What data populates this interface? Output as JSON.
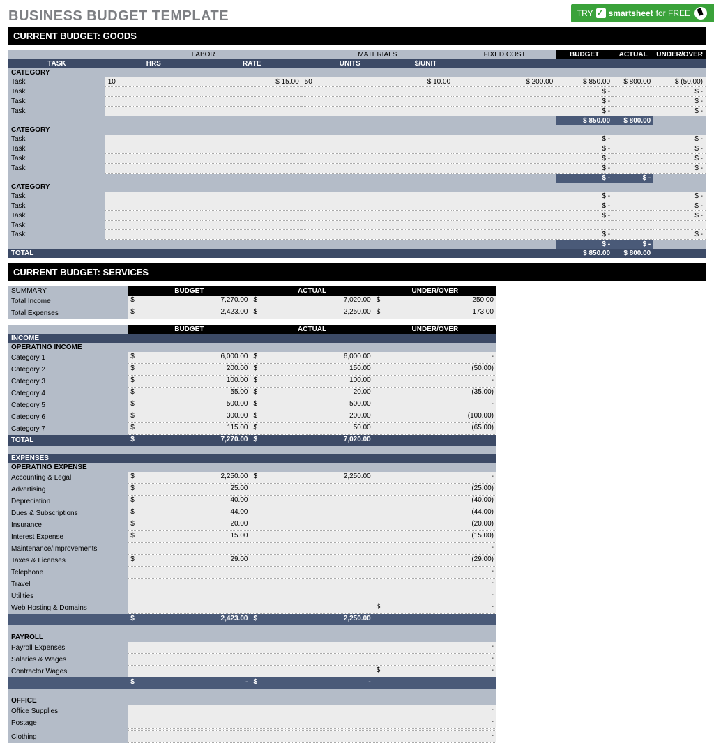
{
  "title": "BUSINESS BUDGET TEMPLATE",
  "badge": {
    "try": "TRY",
    "brand": "smartsheet",
    "tail": "for FREE"
  },
  "goods": {
    "header": "CURRENT BUDGET: GOODS",
    "groups": {
      "labor": "LABOR",
      "materials": "MATERIALS",
      "fixed": "FIXED COST",
      "budget": "BUDGET",
      "actual": "ACTUAL",
      "uo": "UNDER/OVER"
    },
    "cols": {
      "task": "TASK",
      "hrs": "HRS",
      "rate": "RATE",
      "units": "UNITS",
      "perunit": "$/UNIT"
    },
    "categories": [
      {
        "name": "CATEGORY",
        "rows": [
          {
            "task": "Task",
            "hrs": "10",
            "rate": "$        15.00",
            "units": "50",
            "perunit": "$   10.00",
            "fixed": "$ 200.00",
            "budget": "$   850.00",
            "actual": "$   800.00",
            "uo": "$   (50.00)"
          },
          {
            "task": "Task",
            "budget": "$        -",
            "uo": "$        -"
          },
          {
            "task": "Task",
            "budget": "$        -",
            "uo": "$        -"
          },
          {
            "task": "Task",
            "budget": "$        -",
            "uo": "$        -"
          }
        ],
        "sum": {
          "budget": "$   850.00",
          "actual": "$   800.00"
        }
      },
      {
        "name": "CATEGORY",
        "rows": [
          {
            "task": "Task",
            "budget": "$        -",
            "uo": "$        -"
          },
          {
            "task": "Task",
            "budget": "$        -",
            "uo": "$        -"
          },
          {
            "task": "Task",
            "budget": "$        -",
            "uo": "$        -"
          },
          {
            "task": "Task",
            "budget": "$        -",
            "uo": "$        -"
          }
        ],
        "sum": {
          "budget": "$        -",
          "actual": "$        -"
        }
      },
      {
        "name": "CATEGORY",
        "rows": [
          {
            "task": "Task",
            "budget": "$        -",
            "uo": "$        -"
          },
          {
            "task": "Task",
            "budget": "$        -",
            "uo": "$        -"
          },
          {
            "task": "Task",
            "budget": "$        -",
            "uo": "$        -"
          },
          {
            "task": "Task"
          },
          {
            "task": "Task",
            "budget": "$        -",
            "uo": "$        -"
          }
        ],
        "sum": {
          "budget": "$        -",
          "actual": "$        -"
        }
      }
    ],
    "total": {
      "label": "TOTAL",
      "budget": "$   850.00",
      "actual": "$   800.00"
    }
  },
  "services": {
    "header": "CURRENT BUDGET: SERVICES",
    "summary": {
      "label": "SUMMARY",
      "cols": {
        "budget": "BUDGET",
        "actual": "ACTUAL",
        "uo": "UNDER/OVER"
      },
      "rows": [
        {
          "name": "Total Income",
          "budget": "7,270.00",
          "actual": "7,020.00",
          "uo": "250.00"
        },
        {
          "name": "Total Expenses",
          "budget": "2,423.00",
          "actual": "2,250.00",
          "uo": "173.00"
        }
      ]
    },
    "cols": {
      "budget": "BUDGET",
      "actual": "ACTUAL",
      "uo": "UNDER/OVER"
    },
    "income": {
      "label": "INCOME",
      "sub": "OPERATING INCOME",
      "rows": [
        {
          "name": "Category 1",
          "budget": "6,000.00",
          "actual": "6,000.00",
          "uo": "-"
        },
        {
          "name": "Category 2",
          "budget": "200.00",
          "actual": "150.00",
          "uo": "(50.00)"
        },
        {
          "name": "Category 3",
          "budget": "100.00",
          "actual": "100.00",
          "uo": "-"
        },
        {
          "name": "Category 4",
          "budget": "55.00",
          "actual": "20.00",
          "uo": "(35.00)"
        },
        {
          "name": "Category 5",
          "budget": "500.00",
          "actual": "500.00",
          "uo": "-"
        },
        {
          "name": "Category 6",
          "budget": "300.00",
          "actual": "200.00",
          "uo": "(100.00)"
        },
        {
          "name": "Category 7",
          "budget": "115.00",
          "actual": "50.00",
          "uo": "(65.00)"
        }
      ],
      "total": {
        "label": "TOTAL",
        "budget": "7,270.00",
        "actual": "7,020.00"
      }
    },
    "expenses": {
      "label": "EXPENSES",
      "groups": [
        {
          "sub": "OPERATING EXPENSE",
          "rows": [
            {
              "name": "Accounting & Legal",
              "budget": "2,250.00",
              "actual": "2,250.00",
              "uo": "-"
            },
            {
              "name": "Advertising",
              "budget": "25.00",
              "uo": "(25.00)"
            },
            {
              "name": "Depreciation",
              "budget": "40.00",
              "uo": "(40.00)"
            },
            {
              "name": "Dues & Subscriptions",
              "budget": "44.00",
              "uo": "(44.00)"
            },
            {
              "name": "Insurance",
              "budget": "20.00",
              "uo": "(20.00)"
            },
            {
              "name": "Interest Expense",
              "budget": "15.00",
              "uo": "(15.00)"
            },
            {
              "name": "Maintenance/Improvements",
              "uo": "-"
            },
            {
              "name": "Taxes & Licenses",
              "budget": "29.00",
              "uo": "(29.00)"
            },
            {
              "name": "Telephone",
              "uo": "-"
            },
            {
              "name": "Travel",
              "uo": "-"
            },
            {
              "name": "Utilities",
              "uo": "-"
            },
            {
              "name": "Web Hosting & Domains",
              "uo_sym": "$",
              "uo": "-"
            }
          ],
          "subtotal": {
            "budget": "2,423.00",
            "actual": "2,250.00"
          }
        },
        {
          "sub": "PAYROLL",
          "rows": [
            {
              "name": "Payroll Expenses",
              "uo": "-"
            },
            {
              "name": "Salaries & Wages",
              "uo": "-"
            },
            {
              "name": "Contractor Wages",
              "uo_sym": "$",
              "uo": "-"
            }
          ],
          "subtotal": {
            "budget": "-",
            "actual": "-"
          }
        },
        {
          "sub": "OFFICE",
          "rows": [
            {
              "name": "Office Supplies",
              "uo": "-"
            },
            {
              "name": "Postage",
              "uo": "-"
            },
            {
              "name": ""
            },
            {
              "name": "Clothing",
              "uo": "-"
            }
          ]
        }
      ]
    }
  }
}
